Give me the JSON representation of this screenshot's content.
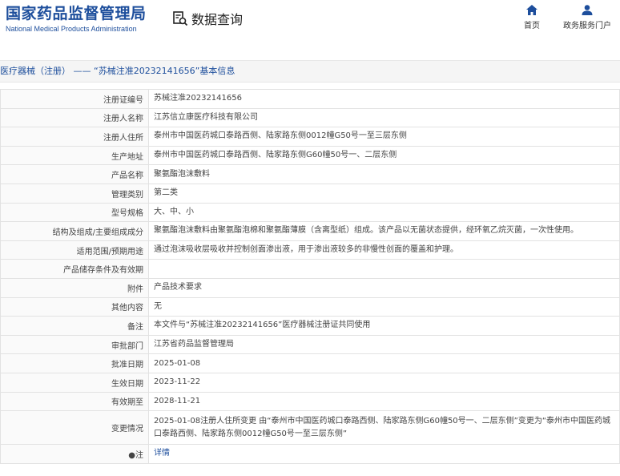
{
  "header": {
    "logo_cn": "国家药品监督管理局",
    "logo_en": "National Medical Products Administration",
    "query_label": "数据查询",
    "nav_home": "首页",
    "nav_portal": "政务服务门户"
  },
  "breadcrumb": "医疗器械（注册） —— “苏械注准20232141656”基本信息",
  "rows": [
    {
      "key": "注册证编号",
      "value": "苏械注准20232141656"
    },
    {
      "key": "注册人名称",
      "value": "江苏信立康医疗科技有限公司"
    },
    {
      "key": "注册人住所",
      "value": "泰州市中国医药城口泰路西侧、陆家路东侧0012幢G50号一至三层东侧"
    },
    {
      "key": "生产地址",
      "value": "泰州市中国医药城口泰路西侧、陆家路东侧G60幢50号一、二层东侧"
    },
    {
      "key": "产品名称",
      "value": "聚氨酯泡沫敷料"
    },
    {
      "key": "管理类别",
      "value": "第二类"
    },
    {
      "key": "型号规格",
      "value": "大、中、小"
    },
    {
      "key": "结构及组成/主要组成成分",
      "value": "聚氨酯泡沫敷料由聚氨酯泡棉和聚氨酯薄膜（含离型纸）组成。该产品以无菌状态提供，经环氧乙烷灭菌，一次性使用。"
    },
    {
      "key": "适用范围/预期用途",
      "value": "通过泡沫吸收层吸收并控制创面渗出液，用于渗出液较多的非慢性创面的覆盖和护理。"
    },
    {
      "key": "产品储存条件及有效期",
      "value": ""
    },
    {
      "key": "附件",
      "value": "产品技术要求"
    },
    {
      "key": "其他内容",
      "value": "无"
    },
    {
      "key": "备注",
      "value": "本文件与“苏械注准20232141656”医疗器械注册证共同使用"
    },
    {
      "key": "审批部门",
      "value": "江苏省药品监督管理局"
    },
    {
      "key": "批准日期",
      "value": "2025-01-08"
    },
    {
      "key": "生效日期",
      "value": "2023-11-22"
    },
    {
      "key": "有效期至",
      "value": "2028-11-21"
    },
    {
      "key": "变更情况",
      "value": "2025-01-08注册人住所变更 由“泰州市中国医药城口泰路西侧、陆家路东侧G60幢50号一、二层东侧”变更为“泰州市中国医药城口泰路西侧、陆家路东侧0012幢G50号一至三层东侧”"
    },
    {
      "key": "●注",
      "value": "详情"
    }
  ]
}
